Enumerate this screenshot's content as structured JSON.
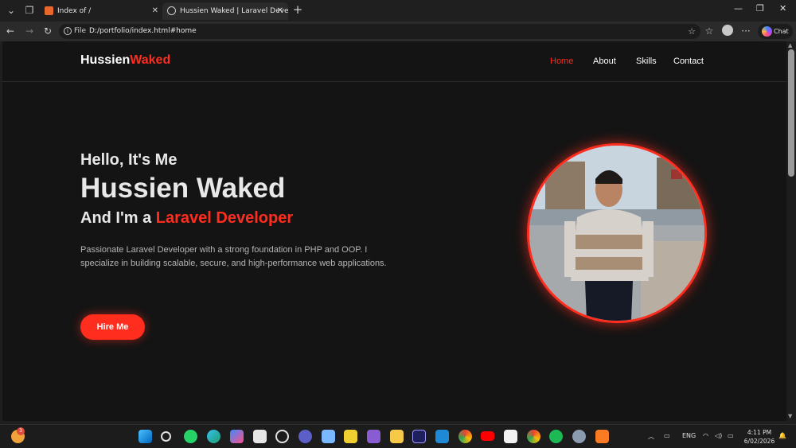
{
  "browser": {
    "tabs": [
      {
        "title": "Index of /"
      },
      {
        "title": "Hussien Waked | Laravel Developer"
      }
    ],
    "address": {
      "scheme_label": "File",
      "url": "D:/portfolio/index.html#home"
    },
    "chat_label": "Chat"
  },
  "site": {
    "brand": {
      "first": "Hussien",
      "accent": "Waked"
    },
    "nav": [
      "Home",
      "About",
      "Skills",
      "Contact"
    ],
    "hero": {
      "greeting": "Hello, It's Me",
      "name": "Hussien Waked",
      "role_prefix": "And I'm a",
      "role_accent": "Laravel Developer",
      "description": "Passionate Laravel Developer with a strong foundation in PHP and OOP. I specialize in building scalable, secure, and high-performance web applications.",
      "cta": "Hire Me"
    },
    "accent_color": "#ff2d1e"
  },
  "taskbar": {
    "notification_badge": "3",
    "language": "ENG",
    "time": "4:11 PM",
    "date": "6/02/2026"
  }
}
